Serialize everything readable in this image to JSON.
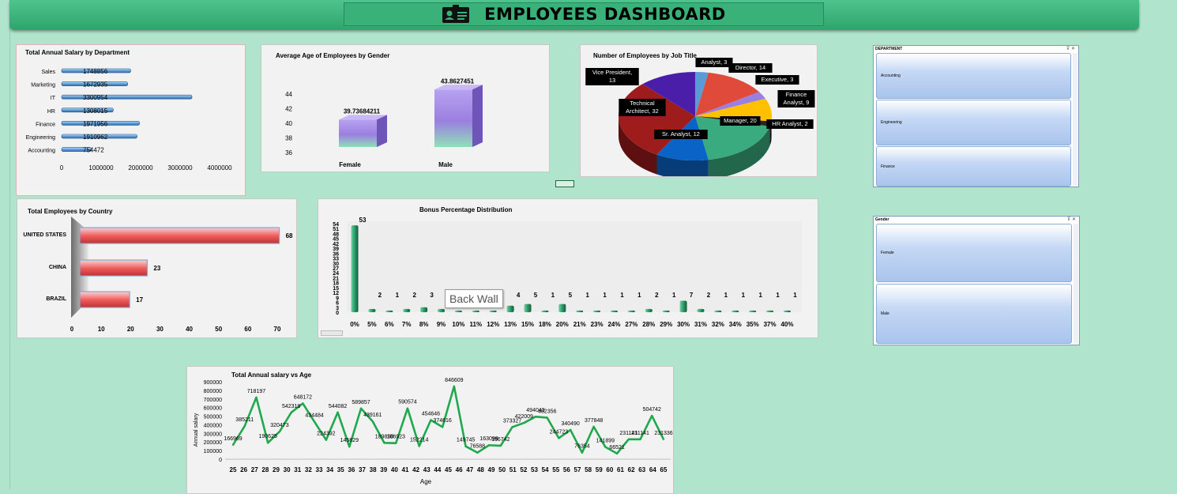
{
  "dashboard": {
    "title": "EMPLOYEES DASHBOARD",
    "icon": "id-card-icon"
  },
  "tooltip": "Back Wall",
  "slicers": {
    "department": {
      "header": "DEPARTMENT",
      "items": [
        "Accounting",
        "Engineering",
        "Finance"
      ]
    },
    "gender": {
      "header": "Gender",
      "items": [
        "Female",
        "Male"
      ]
    }
  },
  "chart_data": [
    {
      "id": "salary_by_department",
      "type": "bar",
      "orientation": "horizontal",
      "title": "Total Annual Salary by Department",
      "categories": [
        "Sales",
        "Marketing",
        "IT",
        "HR",
        "Finance",
        "Engineering",
        "Accounting"
      ],
      "values": [
        1748856,
        1672935,
        3300954,
        1308015,
        1971956,
        1910962,
        754472
      ],
      "xlim": [
        0,
        4000000
      ],
      "xticks": [
        0,
        1000000,
        2000000,
        3000000,
        4000000
      ],
      "color": "#5b9bd5"
    },
    {
      "id": "avg_age_by_gender",
      "type": "bar",
      "title": "Average Age of Employees by Gender",
      "categories": [
        "Female",
        "Male"
      ],
      "values": [
        39.73684211,
        43.8627451
      ],
      "ylim": [
        36,
        44
      ],
      "yticks": [
        36,
        38,
        40,
        42,
        44
      ],
      "color": "#9b7fe0"
    },
    {
      "id": "employees_by_job_title",
      "type": "pie",
      "title": "Number of Employees by Job Title",
      "slices": [
        {
          "label": "Analyst",
          "value": 3,
          "color": "#5b9bd5"
        },
        {
          "label": "Director",
          "value": 14,
          "color": "#e04a3a"
        },
        {
          "label": "Executive",
          "value": 3,
          "color": "#9b7fe0"
        },
        {
          "label": "Finance Analyst",
          "value": 9,
          "color": "#ffc000"
        },
        {
          "label": "HR Analyst",
          "value": 2,
          "color": "#262626"
        },
        {
          "label": "Manager",
          "value": 20,
          "color": "#3aaa7f"
        },
        {
          "label": "Sr. Analyst",
          "value": 12,
          "color": "#0a64c8"
        },
        {
          "label": "Technical Architect",
          "value": 32,
          "color": "#9e1c1c"
        },
        {
          "label": "Vice President",
          "value": 13,
          "color": "#4a1ea8"
        }
      ]
    },
    {
      "id": "employees_by_country",
      "type": "bar",
      "orientation": "horizontal",
      "title": "Total Employees by Country",
      "categories": [
        "UNITED STATES",
        "CHINA",
        "BRAZIL"
      ],
      "values": [
        68,
        23,
        17
      ],
      "xlim": [
        0,
        70
      ],
      "xticks": [
        0,
        10,
        20,
        30,
        40,
        50,
        60,
        70
      ],
      "color": "#f08080"
    },
    {
      "id": "bonus_distribution",
      "type": "bar",
      "title": "Bonus Percentage Distribution",
      "categories": [
        "0%",
        "5%",
        "6%",
        "7%",
        "8%",
        "9%",
        "10%",
        "11%",
        "12%",
        "13%",
        "15%",
        "18%",
        "20%",
        "21%",
        "23%",
        "24%",
        "27%",
        "28%",
        "29%",
        "30%",
        "31%",
        "32%",
        "34%",
        "35%",
        "37%",
        "40%"
      ],
      "values": [
        53,
        2,
        1,
        2,
        3,
        2,
        1,
        1,
        1,
        4,
        5,
        1,
        5,
        1,
        1,
        1,
        1,
        2,
        1,
        7,
        2,
        1,
        1,
        1,
        1,
        1
      ],
      "ylim": [
        0,
        54
      ],
      "yticks": [
        0,
        3,
        6,
        9,
        12,
        15,
        18,
        21,
        24,
        27,
        30,
        33,
        36,
        39,
        42,
        45,
        48,
        51,
        54
      ],
      "color": "#2e9a6a"
    },
    {
      "id": "salary_vs_age",
      "type": "line",
      "title": "Total Annual salary vs Age",
      "xlabel": "Age",
      "ylabel": "Annual salary",
      "x": [
        25,
        26,
        27,
        28,
        29,
        30,
        31,
        32,
        33,
        34,
        35,
        36,
        37,
        38,
        39,
        40,
        41,
        42,
        43,
        44,
        45,
        46,
        47,
        48,
        49,
        50,
        51,
        52,
        53,
        54,
        55,
        56,
        57,
        58,
        59,
        60,
        61,
        62,
        63,
        64,
        65
      ],
      "values": [
        166969,
        385211,
        718197,
        190625,
        320473,
        542318,
        648172,
        434484,
        224392,
        544082,
        145829,
        589857,
        439161,
        189830,
        186923,
        590574,
        152214,
        454646,
        374616,
        846609,
        149745,
        76588,
        163098,
        156742,
        373327,
        422009,
        494043,
        482356,
        244723,
        340490,
        76354,
        377848,
        141899,
        66521,
        231141,
        231141,
        504742,
        231336
      ],
      "point_labels": [
        "166969",
        "385211",
        "718197",
        "190625",
        "320473",
        "542318",
        "648172",
        "434484",
        "224392",
        "544082",
        "145829",
        "589857",
        "439161",
        "189830",
        "186923",
        "590574",
        "152214",
        "454646",
        "374616",
        "846609",
        "149745",
        "76588",
        "163098",
        "156742",
        "373327",
        "422009",
        "494043",
        "482356",
        "244723",
        "340490",
        "76354",
        "377848",
        "141899",
        "66521",
        "231141",
        "231141",
        "504742",
        "231336"
      ],
      "ylim": [
        0,
        900000
      ],
      "yticks": [
        0,
        100000,
        200000,
        300000,
        400000,
        500000,
        600000,
        700000,
        800000,
        900000
      ],
      "color": "#1fa84c"
    }
  ]
}
